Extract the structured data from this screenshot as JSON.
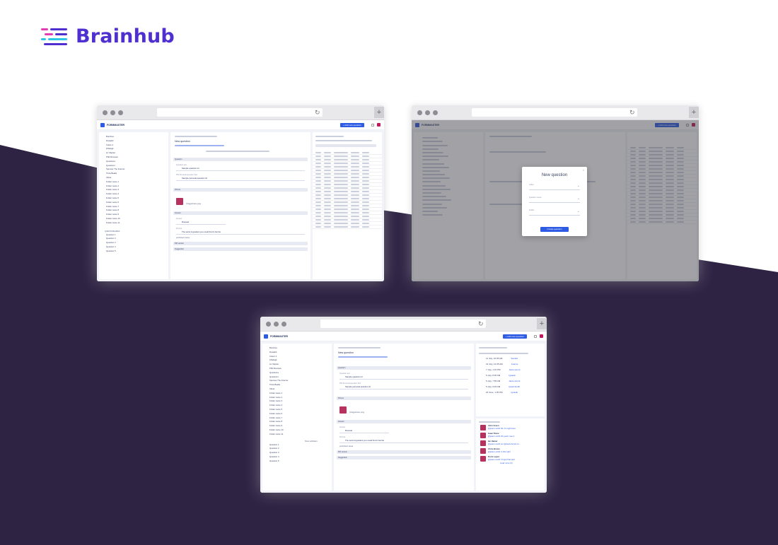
{
  "brand": {
    "name": "Brainhub",
    "accent": "#4f2fd0",
    "mark_colors": [
      "#e33db4",
      "#4f2fd0",
      "#2cc7e7"
    ]
  },
  "background": {
    "dark_band": "#2e2343"
  },
  "app": {
    "name": "FORMMASTER",
    "add_button": "+ Add new question",
    "section_question": "Question",
    "field_question_text_label": "Question text",
    "field_question_text": "Sample question txt",
    "field_personal_label": "PW Personal question Text",
    "field_personal": "Sample personal question txt",
    "section_picture": "Picture",
    "picture_file": "blogpicture.png",
    "section_answer": "Answer",
    "answer_label": "Answer",
    "answer_value": "Roussel",
    "hint_label": "Prompt",
    "hint_text": "The worst ingredient you could find in burrito",
    "proficient": "proficient area",
    "section_pdf": "Pdf version",
    "section_suggestion": "Suggestion",
    "questionnaires_label": "QUESTIONNAIRES",
    "show_subfolders": "Show subfolders",
    "questions": [
      "Question 1",
      "Question 2",
      "Question 3",
      "Question 4",
      "Question 5"
    ],
    "tree": [
      "Bunches",
      "Dosadid",
      "Cdsvc 4",
      "Frllelegk",
      "Liz Zapiter",
      "PhD Reviews",
      "Questiona",
      "Quesiton1",
      "Sponsor The Internet",
      "Trivia Bealls",
      "Ultras",
      "Folder name 1",
      "Folder name 2",
      "Folder name 3",
      "Folder name 4",
      "Folder name 5",
      "Folder name 6",
      "Folder name 7",
      "Folder name 8",
      "Folder name 9",
      "Folder name 10",
      "Folder name 11"
    ]
  },
  "modal": {
    "title": "New question",
    "field1": "Label",
    "field2": "Question name",
    "field3": "Folder",
    "button": "Create question"
  },
  "activity": {
    "rows": [
      {
        "date": "11 July, 10:35 AM",
        "user": "Sandra"
      },
      {
        "date": "19 July, 12:35 AM",
        "user": "Joanne"
      },
      {
        "date": "7 July, 1:15 PM",
        "user": "Janis.vermit"
      },
      {
        "date": "5 July, 8:35 AM",
        "user": "Ignasik"
      },
      {
        "date": "5 July, 7:55 AM",
        "user": "Janis.vermit"
      },
      {
        "date": "5 July, 9:45 AM",
        "user": "Quatt.Smith"
      },
      {
        "date": "20 June, 1:35 PM",
        "user": "Ignasik"
      }
    ]
  },
  "comments": [
    {
      "name": "John Green",
      "text": "@joann.smith Ok. it's right here"
    },
    {
      "name": "Isaac Stone",
      "text": "@joann.smith Ok yeah i see it"
    },
    {
      "name": "Ian Hamer",
      "text": "@joann.smith Let @davis.henze to..."
    },
    {
      "name": "Chris Brown",
      "text": "@joann.smith In this right"
    },
    {
      "name": "Doris Lopez",
      "text": "@joann.smith I forgot that part"
    }
  ],
  "load_more": "Load more (2)"
}
